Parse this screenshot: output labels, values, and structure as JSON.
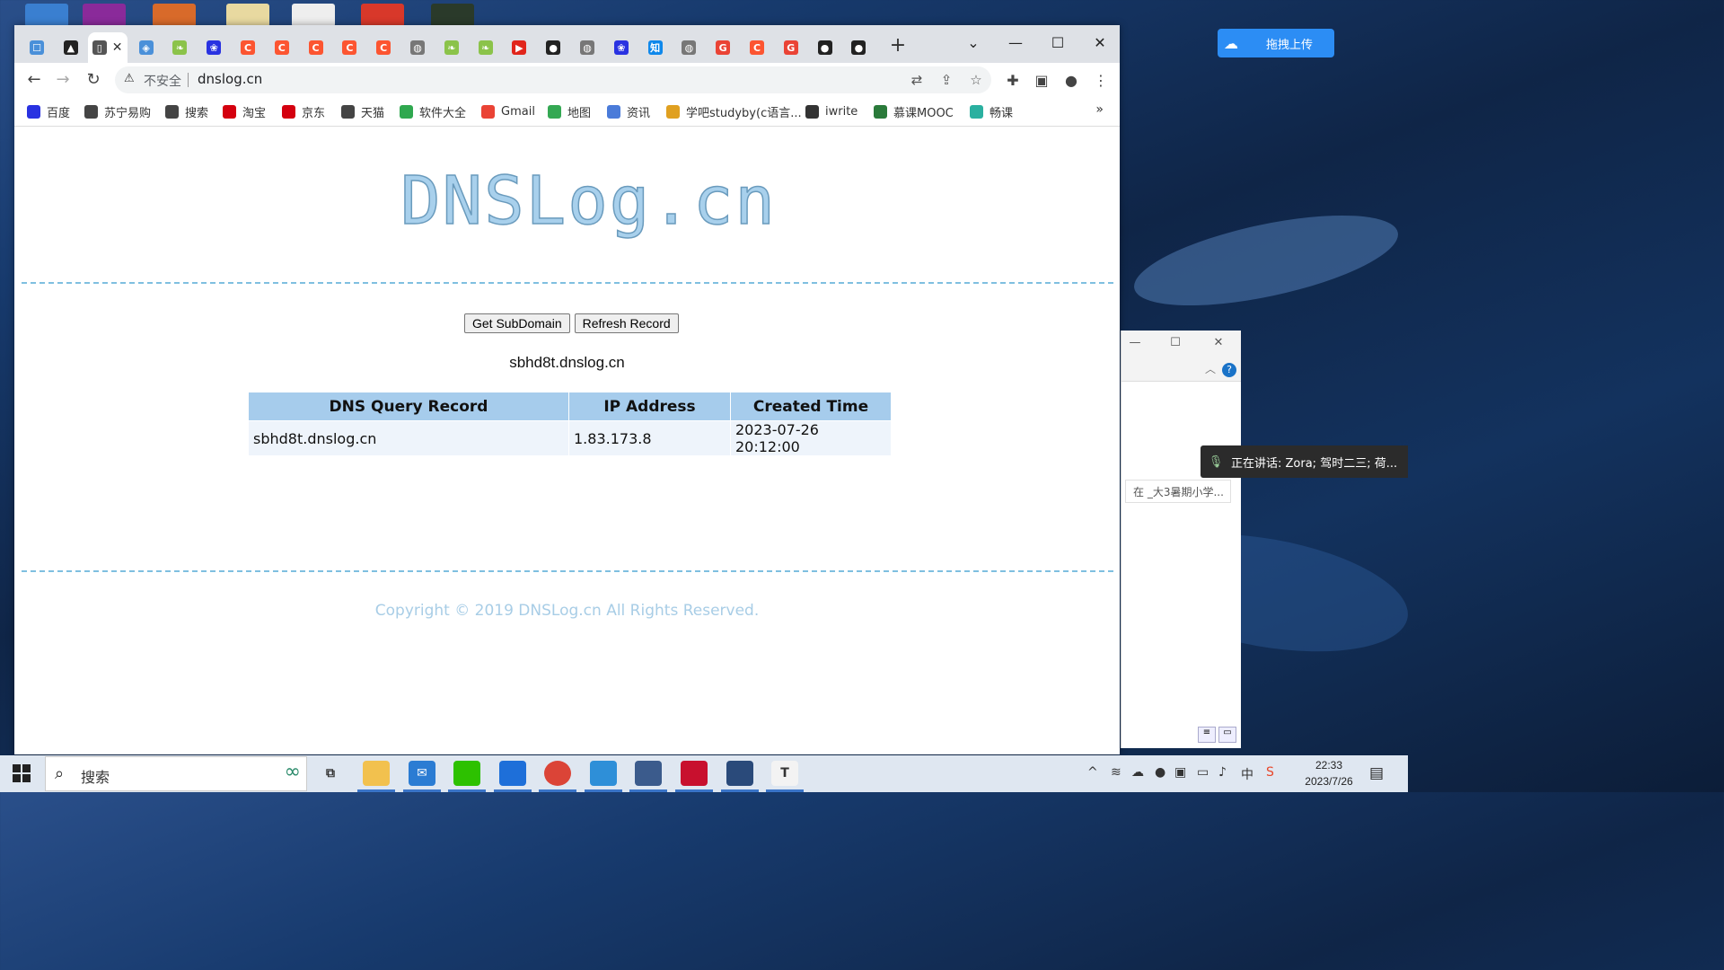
{
  "browser": {
    "url": "dnslog.cn",
    "not_secure": "不安全",
    "tabs": [
      {
        "icon": "robot-icon",
        "color": "#4a90d9"
      },
      {
        "icon": "graduation-cap-icon",
        "color": "#222222"
      },
      {
        "icon": "page-icon",
        "color": "#555555",
        "active": true
      },
      {
        "icon": "shield-icon",
        "color": "#4a90d9"
      },
      {
        "icon": "leaf-icon",
        "color": "#8bc34a"
      },
      {
        "icon": "paw-icon",
        "color": "#2932e1"
      },
      {
        "icon": "csdn-icon",
        "color": "#fc5531"
      },
      {
        "icon": "csdn-icon",
        "color": "#fc5531"
      },
      {
        "icon": "csdn-icon",
        "color": "#fc5531"
      },
      {
        "icon": "csdn-icon",
        "color": "#fc5531"
      },
      {
        "icon": "csdn-icon",
        "color": "#fc5531"
      },
      {
        "icon": "globe-icon",
        "color": "#777777"
      },
      {
        "icon": "leaf-icon",
        "color": "#8bc34a"
      },
      {
        "icon": "leaf-icon",
        "color": "#8bc34a"
      },
      {
        "icon": "play-icon",
        "color": "#e1251b"
      },
      {
        "icon": "github-icon",
        "color": "#222222"
      },
      {
        "icon": "globe-icon",
        "color": "#777777"
      },
      {
        "icon": "paw-icon",
        "color": "#2932e1"
      },
      {
        "icon": "zhihu-icon",
        "color": "#0f88eb"
      },
      {
        "icon": "globe-icon",
        "color": "#777777"
      },
      {
        "icon": "google-icon",
        "color": "#ea4335"
      },
      {
        "icon": "csdn-icon",
        "color": "#fc5531"
      },
      {
        "icon": "google-icon",
        "color": "#ea4335"
      },
      {
        "icon": "github-icon",
        "color": "#222222"
      },
      {
        "icon": "github-icon",
        "color": "#222222"
      }
    ],
    "bookmarks": [
      {
        "label": "百度",
        "icon": "paw-icon",
        "color": "#2932e1"
      },
      {
        "label": "苏宁易购",
        "icon": "globe-icon",
        "color": "#444444"
      },
      {
        "label": "搜索",
        "icon": "globe-icon",
        "color": "#444444"
      },
      {
        "label": "淘宝",
        "icon": "tmall-icon",
        "color": "#d4000f"
      },
      {
        "label": "京东",
        "icon": "jd-icon",
        "color": "#d4000f"
      },
      {
        "label": "天猫",
        "icon": "globe-icon",
        "color": "#444444"
      },
      {
        "label": "软件大全",
        "icon": "download-icon",
        "color": "#2fa84f"
      },
      {
        "label": "Gmail",
        "icon": "google-icon",
        "color": "#ea4335"
      },
      {
        "label": "地图",
        "icon": "map-icon",
        "color": "#34a853"
      },
      {
        "label": "资讯",
        "icon": "news-icon",
        "color": "#4a7bd9"
      },
      {
        "label": "学吧studyby(c语言...",
        "icon": "book-icon",
        "color": "#e0a020"
      },
      {
        "label": "iwrite",
        "icon": "iwrite-icon",
        "color": "#333333"
      },
      {
        "label": "慕课MOOC",
        "icon": "mooc-icon",
        "color": "#2a7a3a"
      },
      {
        "label": "畅课",
        "icon": "pen-icon",
        "color": "#2ab0a0"
      }
    ]
  },
  "page": {
    "logo": "DNSLog.cn",
    "get_subdomain": "Get SubDomain",
    "refresh_record": "Refresh Record",
    "subdomain": "sbhd8t.dnslog.cn",
    "table": {
      "headers": [
        "DNS Query Record",
        "IP Address",
        "Created Time"
      ],
      "rows": [
        [
          "sbhd8t.dnslog.cn",
          "1.83.173.8",
          "2023-07-26 20:12:00"
        ]
      ]
    },
    "copyright": "Copyright © 2019 DNSLog.cn All Rights Reserved."
  },
  "desktop": {
    "upload_label": "拖拽上传",
    "speaking": "正在讲话:  Zora; 驾时二三; 荷...",
    "side_item": "在 _大3暑期小学...",
    "taskbar_search": "搜索",
    "time": "22:33",
    "date": "2023/7/26"
  },
  "colors": {
    "accent": "#a6ccec",
    "row_bg": "#eef4fb",
    "dashed": "#7fbfe0",
    "copyright": "#a8cde6"
  }
}
